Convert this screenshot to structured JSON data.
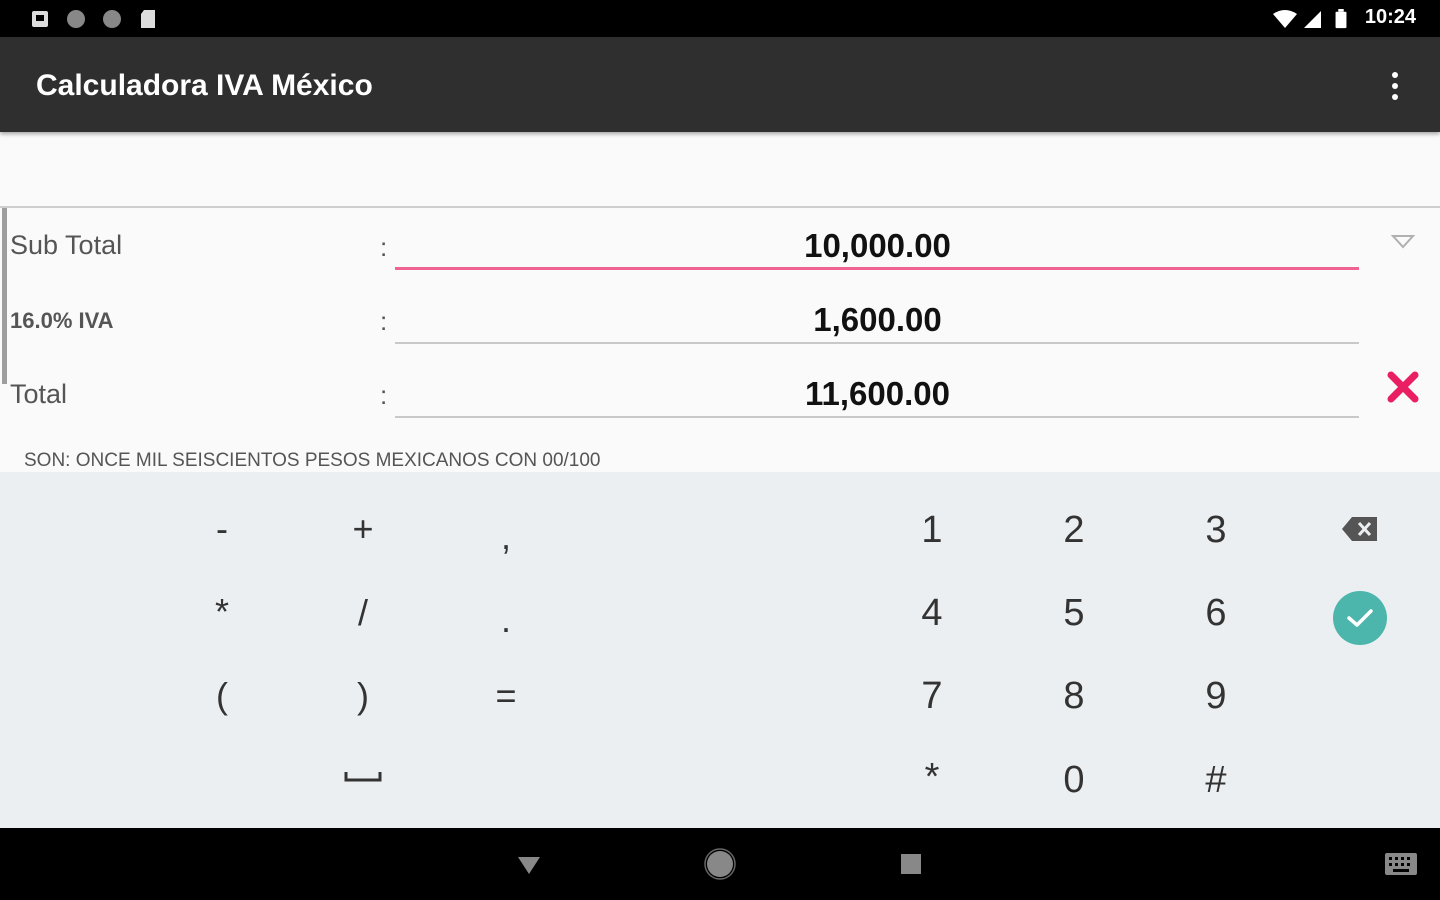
{
  "status_bar": {
    "time": "10:24",
    "left_icons": [
      "notification-icon",
      "circle-icon",
      "circle-icon",
      "sd-card-icon"
    ],
    "right_icons": [
      "wifi-icon",
      "signal-icon",
      "battery-icon"
    ]
  },
  "app_bar": {
    "title": "Calculadora IVA México",
    "menu_icon": "more-vert-icon"
  },
  "form": {
    "rows": [
      {
        "label": "Sub Total",
        "colon": ":",
        "value": "10,000.00"
      },
      {
        "label": "16.0% IVA",
        "colon": ":",
        "value": "1,600.00"
      },
      {
        "label": "Total",
        "colon": ":",
        "value": "11,600.00"
      }
    ],
    "amount_in_words": "SON: ONCE MIL SEISCIENTOS PESOS MEXICANOS CON 00/100"
  },
  "keyboard": {
    "symbol_keys": [
      "-",
      "+",
      ",",
      "*",
      "/",
      ".",
      "(",
      ")",
      "="
    ],
    "space_key_icon": "space-bar-icon",
    "number_keys": [
      "1",
      "2",
      "3",
      "4",
      "5",
      "6",
      "7",
      "8",
      "9",
      "*",
      "0",
      "#"
    ],
    "backspace_icon": "backspace-icon",
    "confirm_icon": "check-icon"
  },
  "nav_bar": {
    "icons": [
      "back-icon",
      "home-icon",
      "recents-icon",
      "keyboard-icon"
    ]
  },
  "colors": {
    "app_bar": "#2f2f2f",
    "active_underline": "#f06292",
    "clear_icon": "#e91e63",
    "confirm_button": "#4db6ac",
    "keyboard_bg": "#eceff1"
  }
}
